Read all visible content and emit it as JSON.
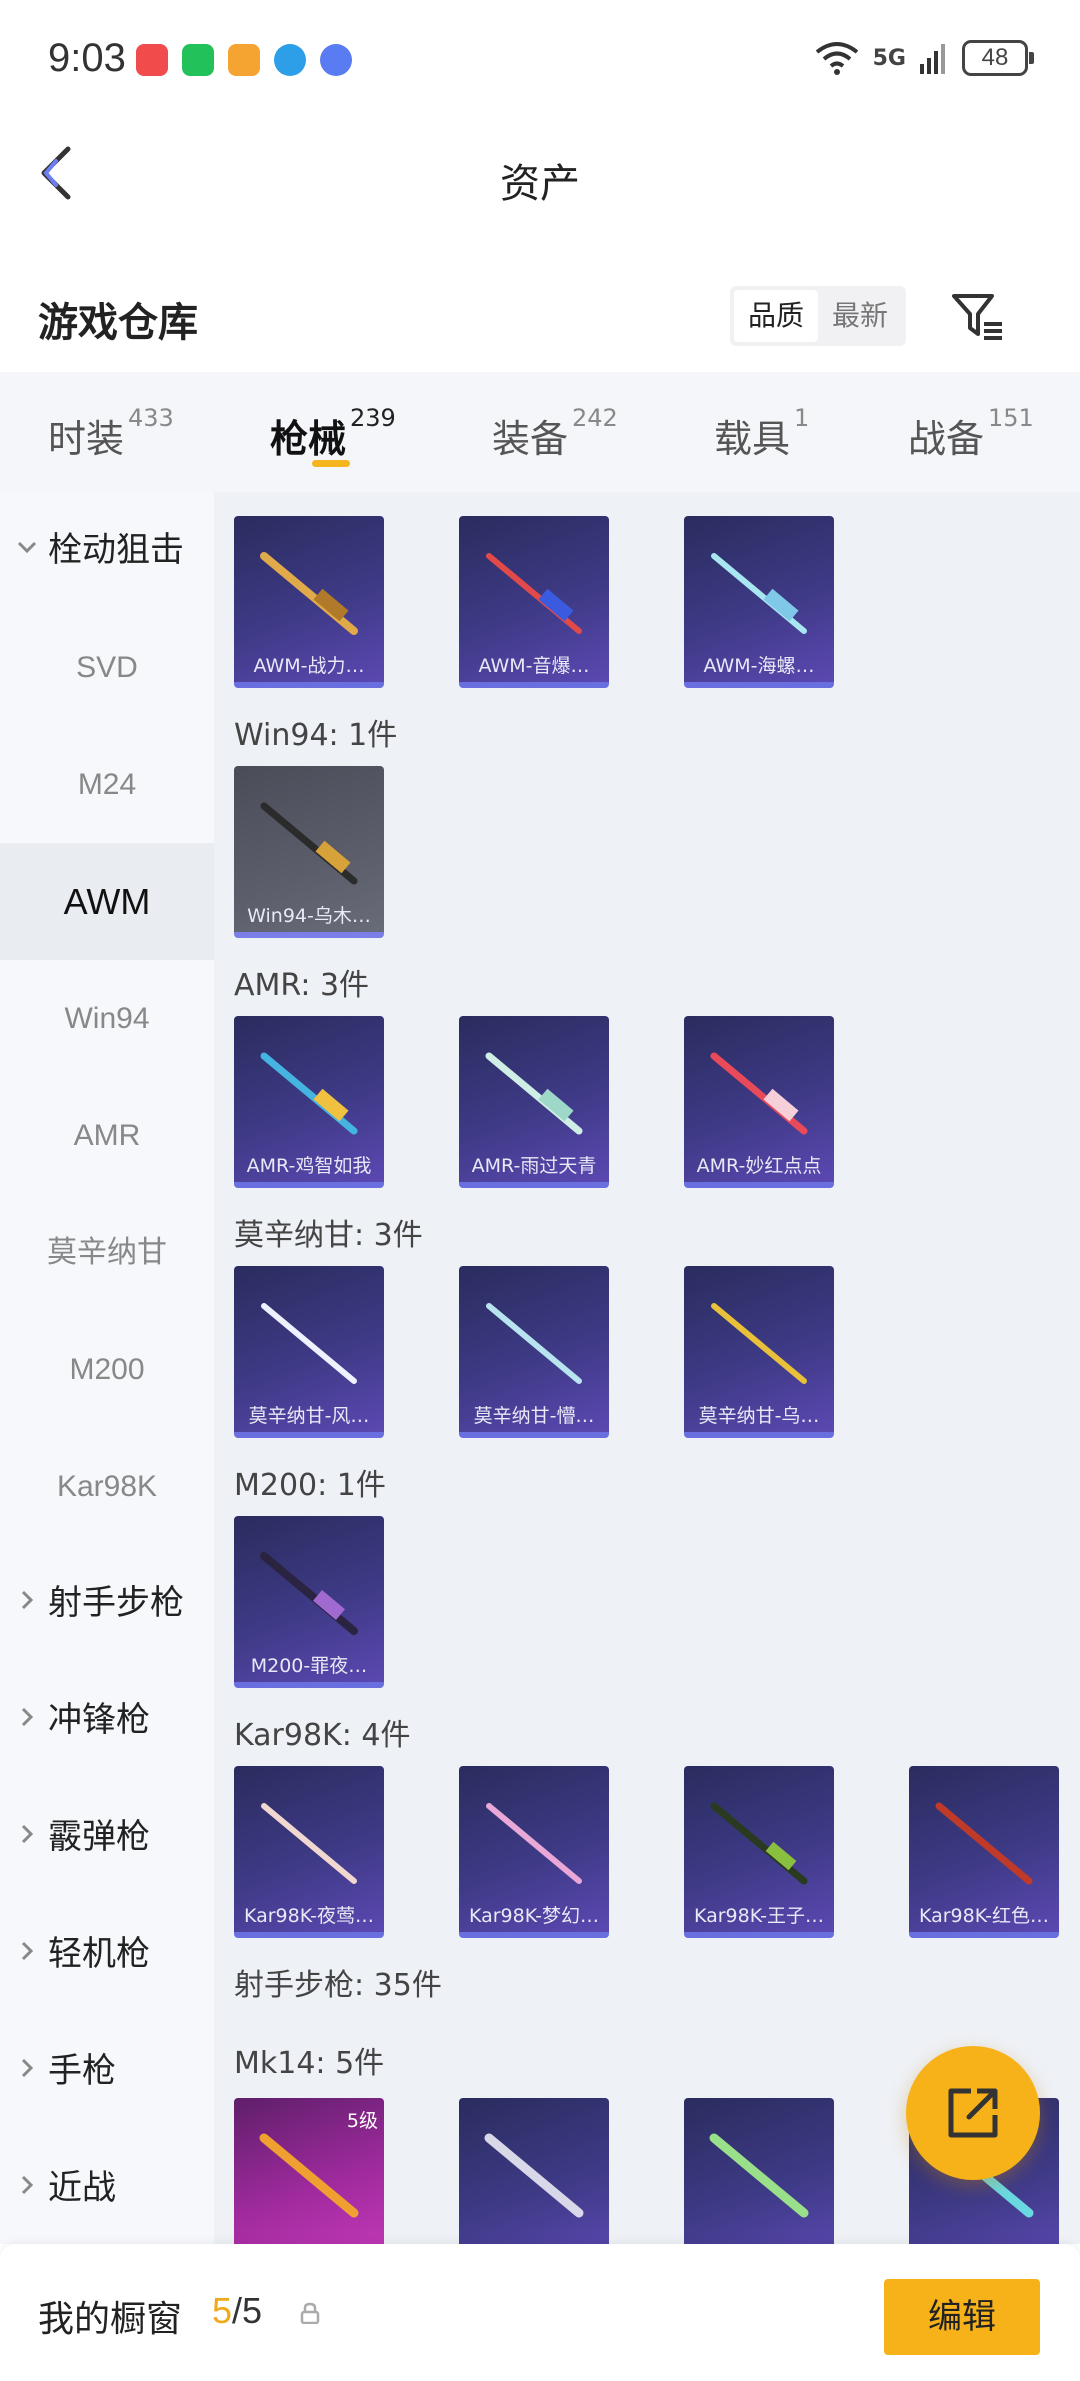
{
  "status_bar": {
    "time": "9:03",
    "network": "5G",
    "battery": "48"
  },
  "nav": {
    "title": "资产"
  },
  "warehouse": {
    "title": "游戏仓库",
    "sort_options": [
      "品质",
      "最新"
    ],
    "active_sort": "品质"
  },
  "tabs": [
    {
      "label": "时装",
      "count": "433"
    },
    {
      "label": "枪械",
      "count": "239"
    },
    {
      "label": "装备",
      "count": "242"
    },
    {
      "label": "载具",
      "count": "1"
    },
    {
      "label": "战备",
      "count": "151"
    }
  ],
  "active_tab": "枪械",
  "sidebar": {
    "expanded_group": "栓动狙击",
    "subitems": [
      "SVD",
      "M24",
      "AWM",
      "Win94",
      "AMR",
      "莫辛纳甘",
      "M200",
      "Kar98K"
    ],
    "active_subitem": "AWM",
    "collapsed_groups": [
      "射手步枪",
      "冲锋枪",
      "霰弹枪",
      "轻机枪",
      "手枪",
      "近战"
    ]
  },
  "content": {
    "top_items": [
      "AWM-战力…",
      "AWM-音爆…",
      "AWM-海螺…"
    ],
    "groups": [
      {
        "label": "Win94: 1件",
        "items": [
          "Win94-乌木…"
        ]
      },
      {
        "label": "AMR: 3件",
        "items": [
          "AMR-鸡智如我",
          "AMR-雨过天青",
          "AMR-妙红点点"
        ]
      },
      {
        "label": "莫辛纳甘: 3件",
        "items": [
          "莫辛纳甘-风…",
          "莫辛纳甘-懵…",
          "莫辛纳甘-乌…"
        ]
      },
      {
        "label": "M200: 1件",
        "items": [
          "M200-罪夜…"
        ]
      },
      {
        "label": "Kar98K: 4件",
        "items": [
          "Kar98K-夜莺…",
          "Kar98K-梦幻…",
          "Kar98K-王子…",
          "Kar98K-红色…"
        ]
      }
    ],
    "section_label": "射手步枪: 35件",
    "mk14_label": "Mk14: 5件",
    "mk14_badge": "5级"
  },
  "bottom_bar": {
    "label": "我的橱窗",
    "count_current": "5",
    "count_sep": "/",
    "count_total": "5",
    "edit_label": "编辑"
  },
  "colors": {
    "accent": "#f7b21a",
    "card_dark": "#3e3a86",
    "card_edge": "#6a6fe0"
  }
}
